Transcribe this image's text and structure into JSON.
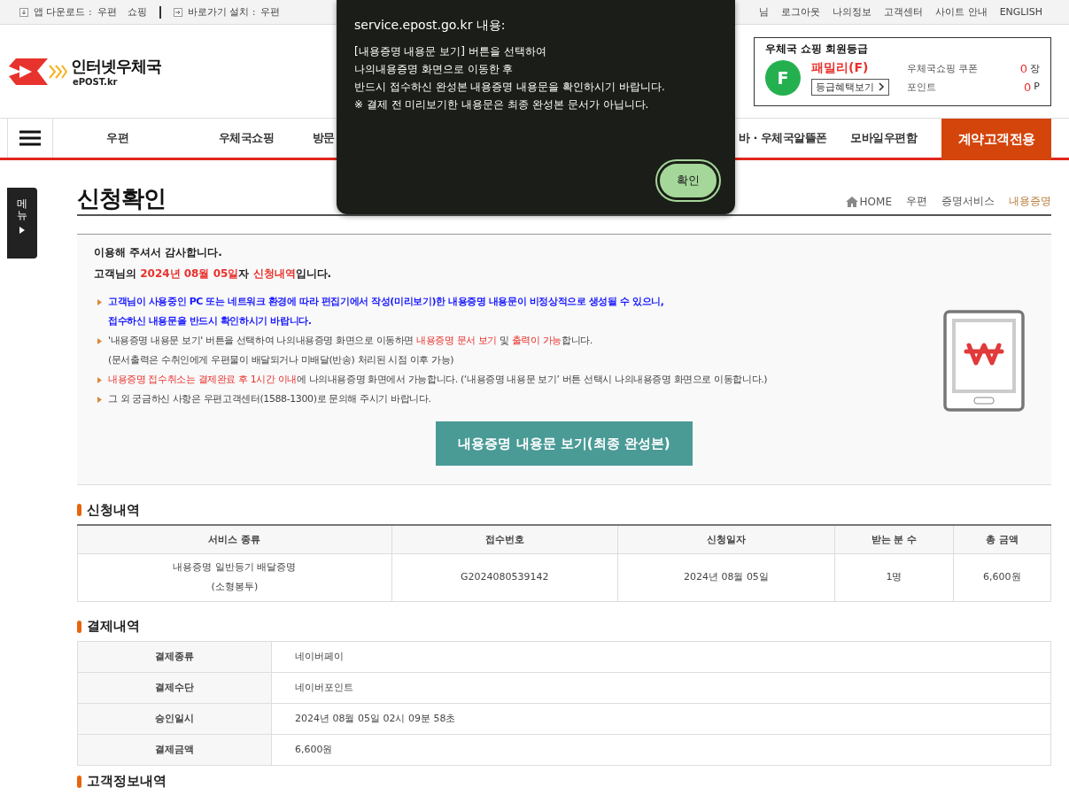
{
  "top_bar": {
    "app_download": {
      "label": "앱 다운로드 :",
      "links": [
        "우편",
        "쇼핑"
      ]
    },
    "shortcut_install": {
      "label": "바로가기 설치 :",
      "links": [
        "우편"
      ]
    },
    "user_suffix": "님",
    "user_links": [
      "로그아웃",
      "나의정보",
      "고객센터",
      "사이트 안내",
      "ENGLISH"
    ]
  },
  "logo": {
    "name": "인터넷우체국",
    "subtitle": "ePOST.kr"
  },
  "grade_box": {
    "title": "우체국 쇼핑 회원등급",
    "badge": "F",
    "grade": "패밀리(F)",
    "benefit_button": "등급혜택보기",
    "stats": [
      {
        "label": "우체국쇼핑 쿠폰",
        "value": "0",
        "unit": "장"
      },
      {
        "label": "포인트",
        "value": "0",
        "unit": "P"
      }
    ]
  },
  "nav": {
    "items": [
      {
        "label": "우편",
        "kind": "left"
      },
      {
        "label": "우체국쇼핑",
        "kind": "left"
      },
      {
        "label": "방문",
        "kind": "left"
      },
      {
        "label": "바 · 우체국알뜰폰",
        "kind": "right"
      },
      {
        "label": "모바일우편함",
        "kind": "right"
      },
      {
        "label": "계약고객전용",
        "kind": "special"
      }
    ]
  },
  "side_menu": {
    "label": "메뉴"
  },
  "page_title": "신청확인",
  "breadcrumb": [
    {
      "label": "HOME",
      "kind": "home",
      "selected": false
    },
    {
      "label": "우편",
      "kind": "text",
      "selected": false
    },
    {
      "label": "증명서비스",
      "kind": "text",
      "selected": false
    },
    {
      "label": "내용증명",
      "kind": "text",
      "selected": true
    }
  ],
  "notice": {
    "thanks": "이용해 주셔서 감사합니다.",
    "summary": [
      {
        "text": "고객님의 ",
        "highlight": false
      },
      {
        "text": "2024년 08월 05일",
        "highlight": true
      },
      {
        "text": "자 ",
        "highlight": false
      },
      {
        "text": "신청내역",
        "highlight": true
      },
      {
        "text": "입니다.",
        "highlight": false
      }
    ],
    "items": [
      {
        "kind": "warning",
        "segments": [
          {
            "text": "고객님이 사용중인 PC 또는 네트워크 환경에 따라 편집기에서 작성(미리보기)한 내용증명 내용문이 비정상적으로 생성될 수 있으니,",
            "highlight": false
          }
        ]
      },
      {
        "kind": "continuation",
        "segments": [
          {
            "text": "접수하신 내용문을 반드시 확인하시기 바랍니다.",
            "highlight": false
          }
        ]
      },
      {
        "kind": "bullet",
        "segments": [
          {
            "text": "'내용증명 내용문 보기' 버튼을 선택하여 나의내용증명 화면으로 이동하면 ",
            "highlight": false
          },
          {
            "text": "내용증명 문서 보기",
            "highlight": true
          },
          {
            "text": " 및 ",
            "highlight": false
          },
          {
            "text": "출력이 가능",
            "highlight": true
          },
          {
            "text": "합니다.",
            "highlight": false
          }
        ]
      },
      {
        "kind": "note",
        "segments": [
          {
            "text": "(문서출력은 수취인에게 우편물이 배달되거나 미배달(반송) 처리된 시점 이후 가능)",
            "highlight": false
          }
        ]
      },
      {
        "kind": "bullet",
        "segments": [
          {
            "text": "내용증명 접수취소는 결제완료 후 1시간 이내",
            "highlight": true
          },
          {
            "text": "에 나의내용증명 화면에서 가능합니다. (‘내용증명 내용문 보기’ 버튼 선택시 나의내용증명 화면으로 이동합니다.)",
            "highlight": false
          }
        ]
      },
      {
        "kind": "bullet",
        "segments": [
          {
            "text": "그 외 궁금하신 사항은 우편고객센터(1588-1300)로 문의해 주시기 바랍니다.",
            "highlight": false
          }
        ]
      }
    ],
    "view_button": "내용증명 내용문 보기(최종 완성본)"
  },
  "application": {
    "title": "신청내역",
    "columns": [
      "서비스 종류",
      "접수번호",
      "신청일자",
      "받는 분 수",
      "총 금액"
    ],
    "rows": [
      [
        "내용증명 일반등기 배달증명\n(소형봉투)",
        "G2024080539142",
        "2024년 08월 05일",
        "1명",
        "6,600원"
      ]
    ]
  },
  "payment": {
    "title": "결제내역",
    "rows": [
      {
        "label": "결제종류",
        "value": "네이버페이"
      },
      {
        "label": "결제수단",
        "value": "네이버포인트"
      },
      {
        "label": "승인일시",
        "value": "2024년 08월 05일 02시 09분 58초"
      },
      {
        "label": "결제금액",
        "value": "6,600원"
      }
    ]
  },
  "customer_info": {
    "title": "고객정보내역"
  },
  "dialog": {
    "title": "service.epost.go.kr 내용:",
    "lines": [
      "[내용증명 내용문 보기] 버튼을 선택하여",
      "나의내용증명 화면으로 이동한 후",
      "반드시 접수하신 완성본 내용증명 내용문을 확인하시기 바랍니다.",
      "※ 결제 전 미리보기한 내용문은 최종 완성본 문서가 아닙니다."
    ],
    "ok_button": "확인"
  }
}
